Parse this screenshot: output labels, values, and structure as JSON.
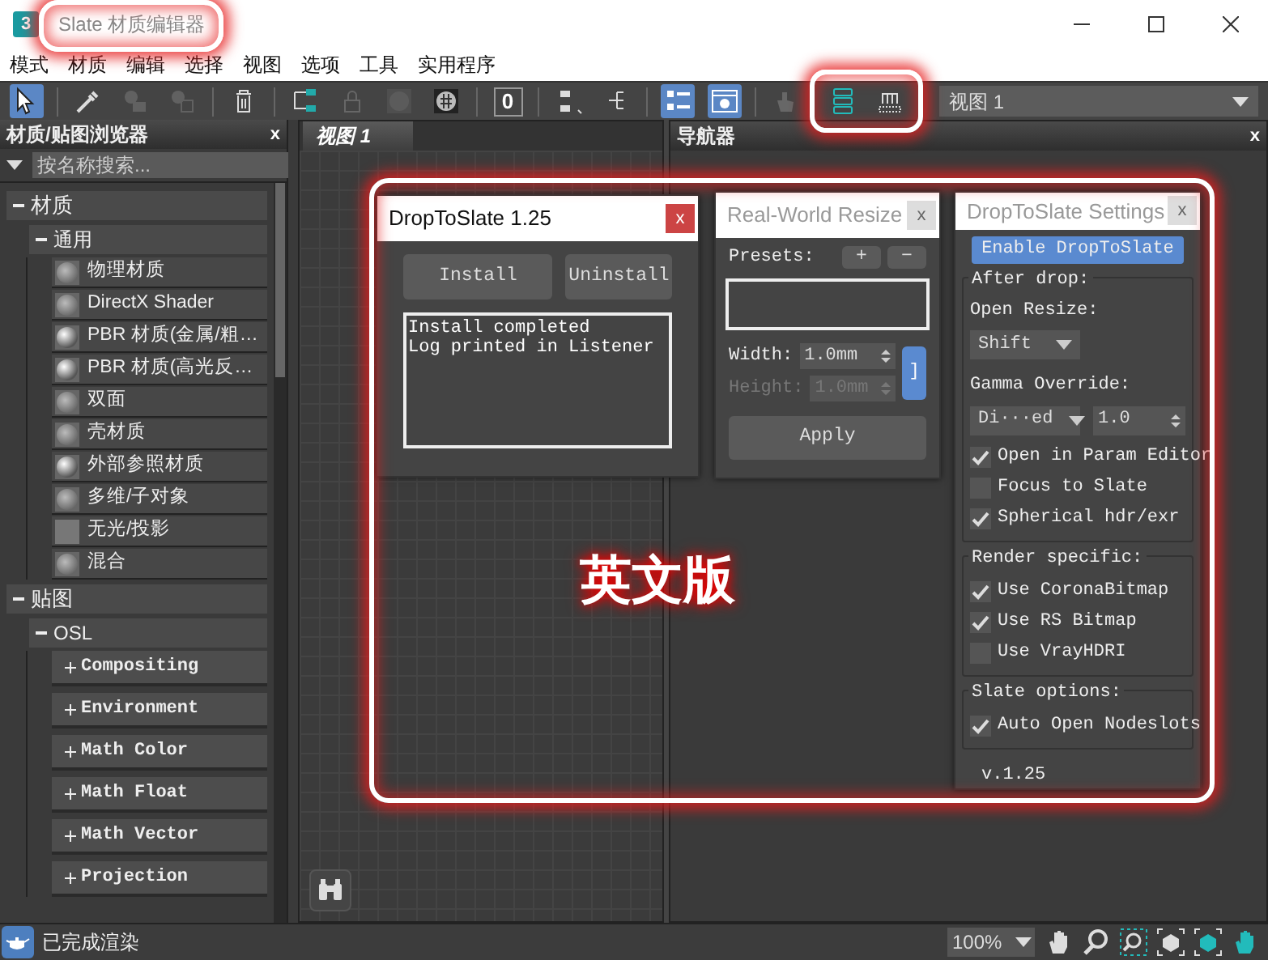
{
  "window": {
    "app_icon": "3",
    "title": "Slate 材质编辑器"
  },
  "menu": [
    "模式",
    "材质",
    "编辑",
    "选择",
    "视图",
    "选项",
    "工具",
    "实用程序"
  ],
  "toolbar": {
    "tools": [
      {
        "kind": "select",
        "active": true,
        "disabled": false
      },
      {
        "kind": "separator"
      },
      {
        "kind": "eyedropper",
        "active": false,
        "disabled": false
      },
      {
        "kind": "pick",
        "active": false,
        "disabled": true
      },
      {
        "kind": "put",
        "active": false,
        "disabled": true
      },
      {
        "kind": "separator"
      },
      {
        "kind": "trash",
        "active": false,
        "disabled": false
      },
      {
        "kind": "separator"
      },
      {
        "kind": "layout",
        "active": false,
        "disabled": false
      },
      {
        "kind": "lock",
        "active": false,
        "disabled": true
      },
      {
        "kind": "sphere",
        "active": false,
        "disabled": true
      },
      {
        "kind": "checker",
        "active": false,
        "disabled": false
      },
      {
        "kind": "separator"
      },
      {
        "kind": "counter",
        "label": "0",
        "active": false,
        "disabled": false
      },
      {
        "kind": "separator"
      },
      {
        "kind": "layout-down",
        "active": false,
        "disabled": false
      },
      {
        "kind": "layout-right",
        "active": false,
        "disabled": false
      },
      {
        "kind": "separator"
      },
      {
        "kind": "list",
        "active": true,
        "disabled": false
      },
      {
        "kind": "preview",
        "active": true,
        "disabled": false
      },
      {
        "kind": "separator"
      },
      {
        "kind": "hand",
        "active": false,
        "disabled": true
      },
      {
        "kind": "stack",
        "active": false,
        "disabled": false
      },
      {
        "kind": "slots",
        "active": false,
        "disabled": false
      }
    ],
    "view_select": "视图 1"
  },
  "browser": {
    "title": "材质/贴图浏览器",
    "close": "x",
    "search_placeholder": "按名称搜索...",
    "tree": [
      {
        "label": "材质",
        "expanded": true,
        "children": [
          {
            "label": "通用",
            "expanded": true,
            "children": [
              {
                "label": "物理材质",
                "kind": "matte"
              },
              {
                "label": "DirectX Shader",
                "kind": "matte"
              },
              {
                "label": "PBR 材质(金属/粗…",
                "kind": "glossy"
              },
              {
                "label": "PBR 材质(高光反…",
                "kind": "glossy"
              },
              {
                "label": "双面",
                "kind": "matte"
              },
              {
                "label": "壳材质",
                "kind": "matte"
              },
              {
                "label": "外部参照材质",
                "kind": "glossy"
              },
              {
                "label": "多维/子对象",
                "kind": "matte"
              },
              {
                "label": "无光/投影",
                "kind": "flat"
              },
              {
                "label": "混合",
                "kind": "matte"
              }
            ]
          }
        ]
      },
      {
        "label": "贴图",
        "expanded": true,
        "children": [
          {
            "label": "OSL",
            "expanded": true,
            "children": [
              {
                "label": "Compositing",
                "expanded": false
              },
              {
                "label": "Environment",
                "expanded": false
              },
              {
                "label": "Math Color",
                "expanded": false
              },
              {
                "label": "Math Float",
                "expanded": false
              },
              {
                "label": "Math Vector",
                "expanded": false
              },
              {
                "label": "Projection",
                "expanded": false
              }
            ]
          }
        ]
      }
    ]
  },
  "view": {
    "tab": "视图 1"
  },
  "navigator": {
    "title": "导航器",
    "close": "x"
  },
  "drop_to_slate": {
    "title": "DropToSlate 1.25",
    "active": true,
    "close": "x",
    "buttons": [
      "Install",
      "Uninstall"
    ],
    "log": [
      "Install completed",
      "Log printed in Listener"
    ]
  },
  "real_world_resize": {
    "title": "Real-World Resize",
    "active": false,
    "close": "x",
    "presets_label": "Presets:",
    "preset_buttons": [
      "+",
      "−"
    ],
    "fields": [
      {
        "label": "Width:",
        "value": "1.0mm",
        "disabled": false
      },
      {
        "label": "Height:",
        "value": "1.0mm",
        "disabled": true
      }
    ],
    "lock": "]",
    "apply": "Apply"
  },
  "settings": {
    "title": "DropToSlate Settings",
    "active": false,
    "close": "x",
    "enable_button": "Enable DropToSlate",
    "groups": [
      {
        "title": "After drop:",
        "items": [
          {
            "kind": "label",
            "text": "Open Resize:"
          },
          {
            "kind": "dropdown",
            "value": "Shift"
          },
          {
            "kind": "label",
            "text": "Gamma Override:"
          },
          {
            "kind": "dropdown_spinner",
            "value": "Di···ed",
            "spinner": "1.0"
          },
          {
            "kind": "checkbox",
            "text": "Open in Param Editor",
            "checked": true
          },
          {
            "kind": "checkbox",
            "text": "Focus to Slate",
            "checked": false
          },
          {
            "kind": "checkbox",
            "text": "Spherical hdr/exr",
            "checked": true
          }
        ]
      },
      {
        "title": "Render specific:",
        "items": [
          {
            "kind": "checkbox",
            "text": "Use CoronaBitmap",
            "checked": true
          },
          {
            "kind": "checkbox",
            "text": "Use RS Bitmap",
            "checked": true
          },
          {
            "kind": "checkbox",
            "text": "Use VrayHDRI",
            "checked": false
          }
        ]
      },
      {
        "title": "Slate options:",
        "items": [
          {
            "kind": "checkbox",
            "text": "Auto Open Nodeslots",
            "checked": true
          }
        ]
      }
    ],
    "version": "v.1.25"
  },
  "status_bar": {
    "text": "已完成渲染",
    "zoom": "100%"
  },
  "annotation": {
    "label": "英文版"
  }
}
